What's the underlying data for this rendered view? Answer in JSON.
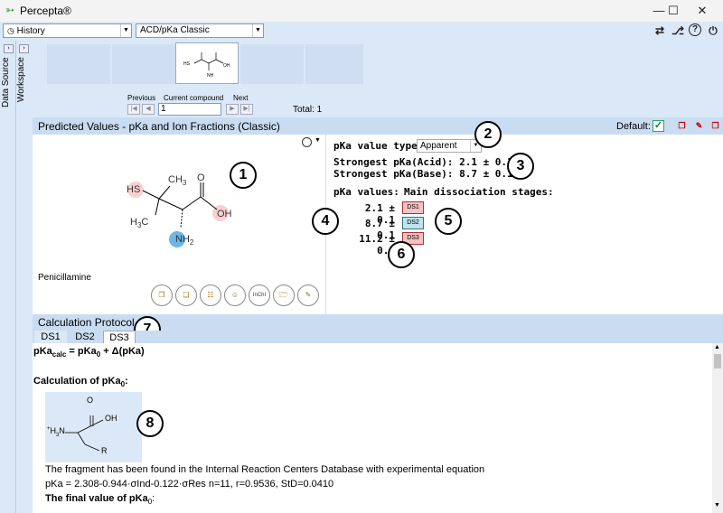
{
  "window": {
    "title": "Percepta®",
    "min": "—",
    "max": "☐",
    "close": "✕"
  },
  "toolbar": {
    "history": "History",
    "module": "ACD/pKa Classic",
    "icons": [
      "swap-icon",
      "tree-icon",
      "help-icon",
      "power-icon"
    ]
  },
  "sidebar": {
    "tabs": [
      "Data Source",
      "Workspace"
    ]
  },
  "nav": {
    "previous": "Previous",
    "current": "Current compound",
    "next": "Next",
    "current_value": "1",
    "total": "Total: 1"
  },
  "header": {
    "title": "Predicted Values - pKa and Ion Fractions (Classic)",
    "default_label": "Default:"
  },
  "structure": {
    "name": "Penicillamine",
    "labels": {
      "hs": "HS",
      "ch3": "CH",
      "ch3_sub": "3",
      "o": "O",
      "oh": "OH",
      "h3c": "H",
      "h3c_sub": "3",
      "h3c_c": "C",
      "nh2": "NH",
      "nh2_sub": "2"
    }
  },
  "results": {
    "type_label": "pKa value type:",
    "type_value": "Apparent",
    "strongest_acid": "Strongest pKa(Acid): 2.1 ± 0.1",
    "strongest_base": "Strongest pKa(Base): 8.7 ± 0.1",
    "values_header": "pKa values:",
    "stages_header": "Main dissociation stages:",
    "rows": [
      {
        "value": "2.1 ± 0.1",
        "stage": "DS1",
        "color": "#f4c2c2"
      },
      {
        "value": "8.7 ± 0.1",
        "stage": "DS2",
        "color": "#bfe3ef"
      },
      {
        "value": "11.2 ± 0.1",
        "stage": "DS3",
        "color": "#f4c2c2"
      }
    ]
  },
  "callouts": [
    "1",
    "2",
    "3",
    "4",
    "5",
    "6",
    "7",
    "8"
  ],
  "protocol": {
    "title": "Calculation Protocol",
    "tabs": [
      "DS1",
      "DS2",
      "DS3"
    ],
    "eq_pre": "pKa",
    "eq_sub": "calc",
    "eq_mid": " = pKa",
    "eq_sub2": "0",
    "eq_post": " + Δ(pKa)",
    "calc_label": "Calculation of pKa",
    "calc_sub": "0",
    "calc_colon": ":",
    "frag_labels": {
      "o": "O",
      "oh": "OH",
      "h3n": "H",
      "h3n_sub": "3",
      "h3n_n": "N",
      "r": "R",
      "plus": "+"
    },
    "found_text": "The fragment has been found in the Internal Reaction Centers Database with experimental equation",
    "equation": "pKa = 2.308-0.944·σInd-0.122·σRes    n=11, r=0.9536, StD=0.0410",
    "final_label": "The final value of pKa",
    "final_sub": "0",
    "final_colon": ":"
  }
}
